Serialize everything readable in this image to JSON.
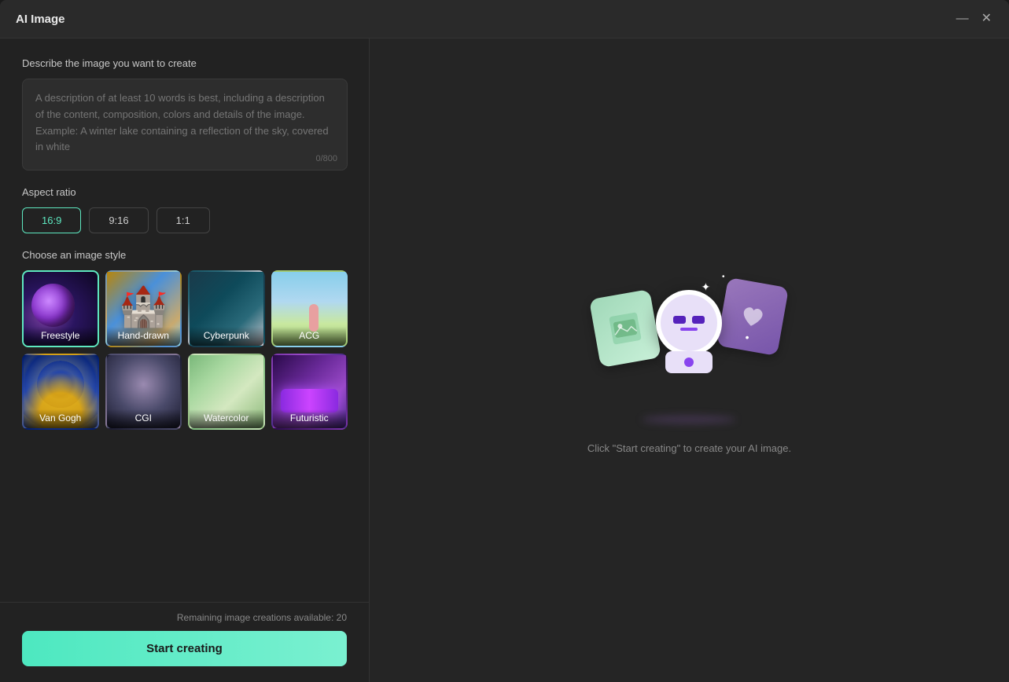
{
  "window": {
    "title": "AI Image"
  },
  "controls": {
    "minimize": "—",
    "close": "✕"
  },
  "left": {
    "description_label": "Describe the image you want to create",
    "textarea_placeholder": "A description of at least 10 words is best, including a description of the content, composition, colors and details of the image. Example: A winter lake containing a reflection of the sky, covered in white",
    "char_count": "0/800",
    "aspect_ratio_label": "Aspect ratio",
    "aspect_options": [
      {
        "label": "16:9",
        "active": true
      },
      {
        "label": "9:16",
        "active": false
      },
      {
        "label": "1:1",
        "active": false
      }
    ],
    "style_label": "Choose an image style",
    "styles": [
      {
        "name": "Freestyle",
        "selected": true,
        "class": "style-freestyle"
      },
      {
        "name": "Hand-drawn",
        "selected": false,
        "class": "style-handdrawn"
      },
      {
        "name": "Cyberpunk",
        "selected": false,
        "class": "style-cyberpunk"
      },
      {
        "name": "ACG",
        "selected": false,
        "class": "style-acg"
      },
      {
        "name": "Van Gogh",
        "selected": false,
        "class": "style-vangogh"
      },
      {
        "name": "CGI",
        "selected": false,
        "class": "style-cgi"
      },
      {
        "name": "Watercolor",
        "selected": false,
        "class": "style-watercolor"
      },
      {
        "name": "Futuristic",
        "selected": false,
        "class": "style-futuristic"
      }
    ],
    "remaining_text": "Remaining image creations available: 20",
    "start_button": "Start creating"
  },
  "right": {
    "instruction": "Click \"Start creating\" to create your AI image."
  }
}
